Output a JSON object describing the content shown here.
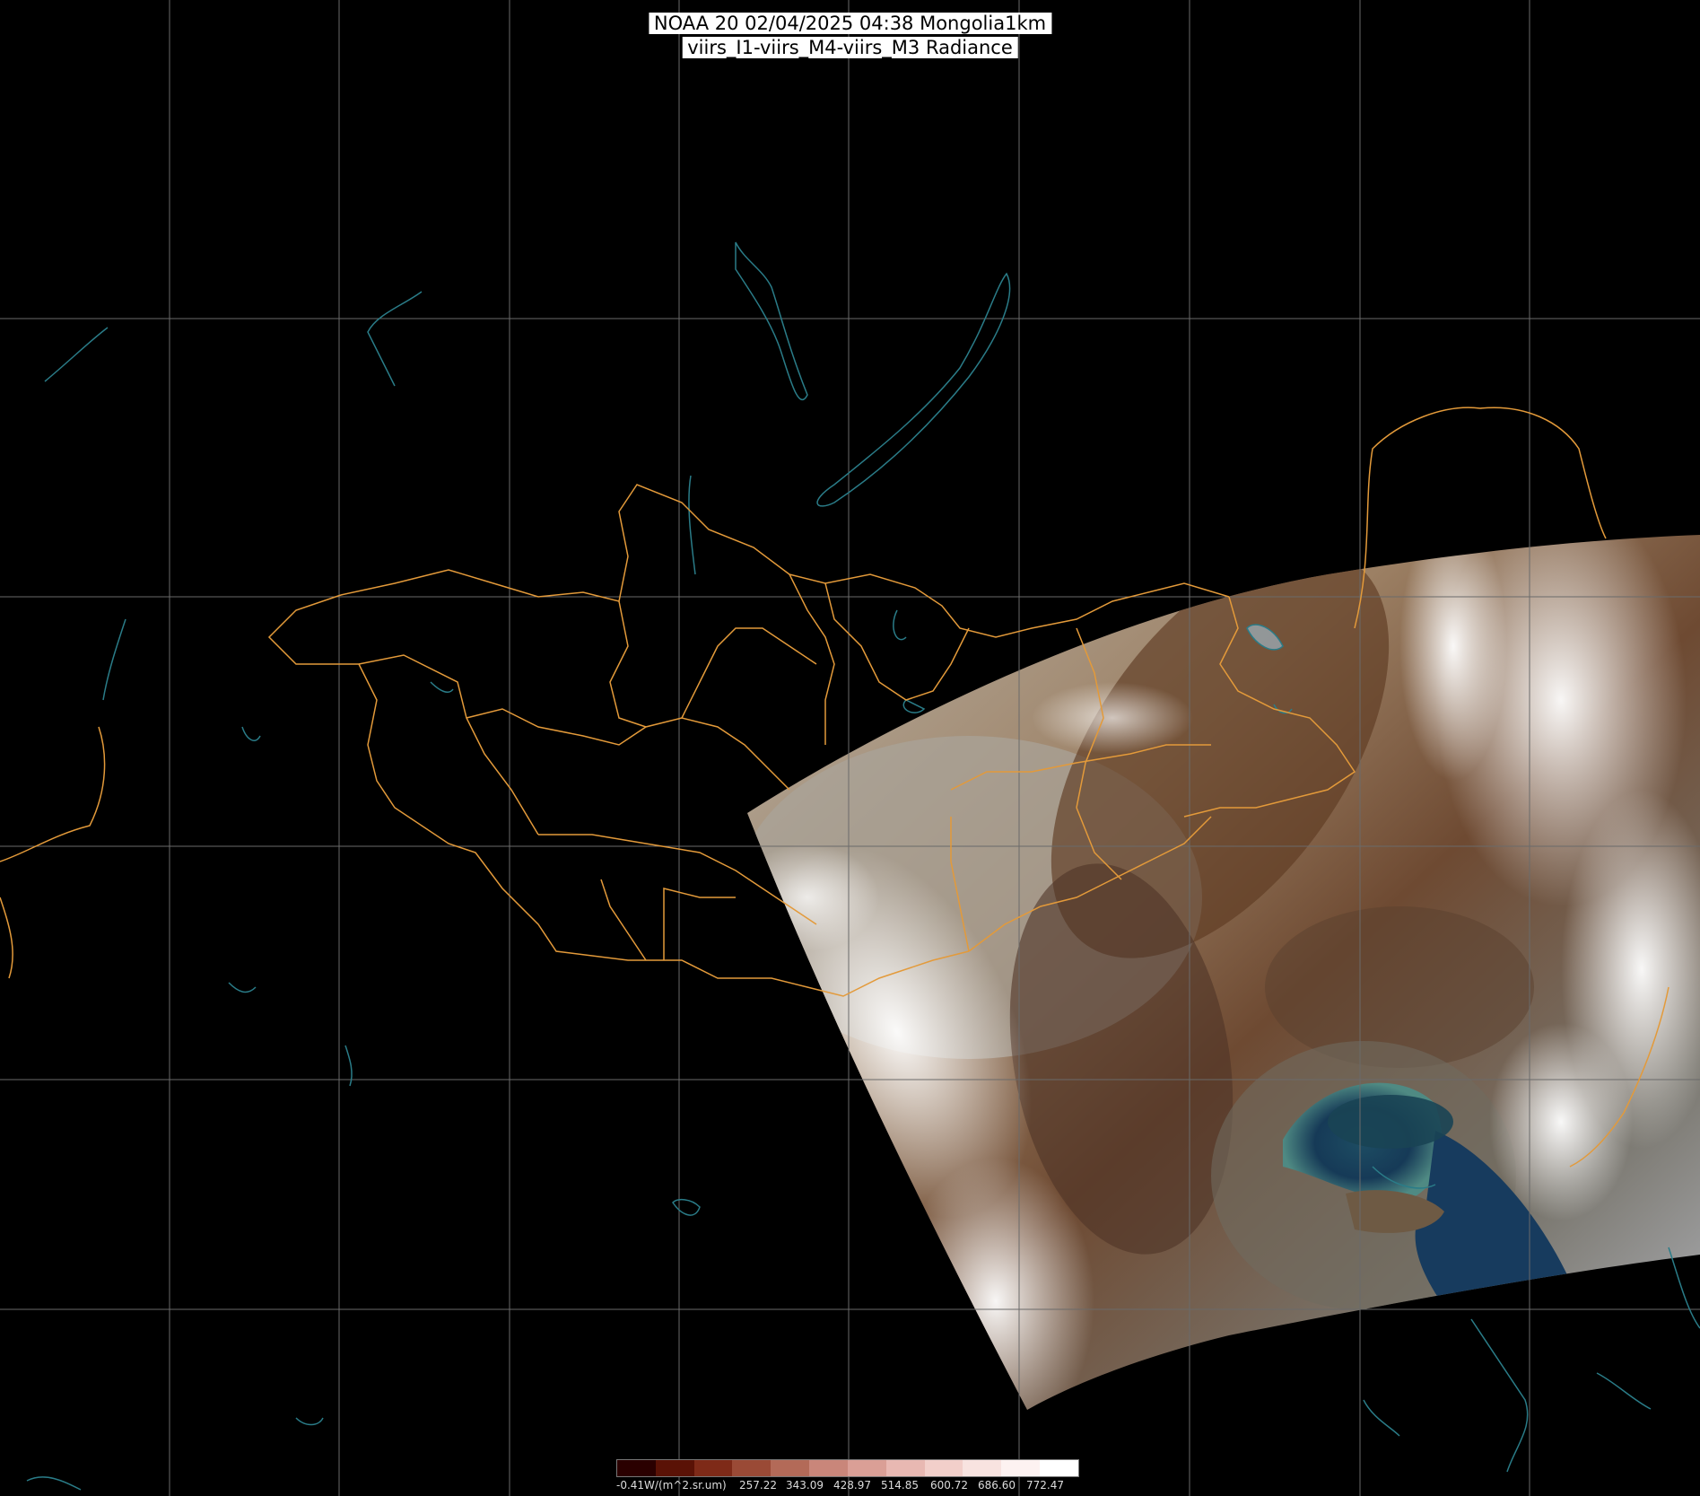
{
  "header": {
    "line1": "NOAA 20 02/04/2025 04:38 Mongolia1km",
    "line2": "viirs_I1-viirs_M4-viirs_M3 Radiance"
  },
  "legend": {
    "unit_label": "-0.41W/(m^2.sr.um)",
    "ticks": [
      "257.22",
      "343.09",
      "428.97",
      "514.85",
      "600.72",
      "686.60",
      "772.47"
    ],
    "colors": [
      "#2a0000",
      "#5a1206",
      "#7e2a18",
      "#9a4a36",
      "#b36a58",
      "#c9867a",
      "#da9f96",
      "#e8b8b2",
      "#f2cfca",
      "#f8e3e0",
      "#fdf2f1",
      "#ffffff"
    ]
  },
  "colors": {
    "grid": "#6a6a6a",
    "admin_border": "#e39a3a",
    "coast_water": "#2a7c88"
  }
}
